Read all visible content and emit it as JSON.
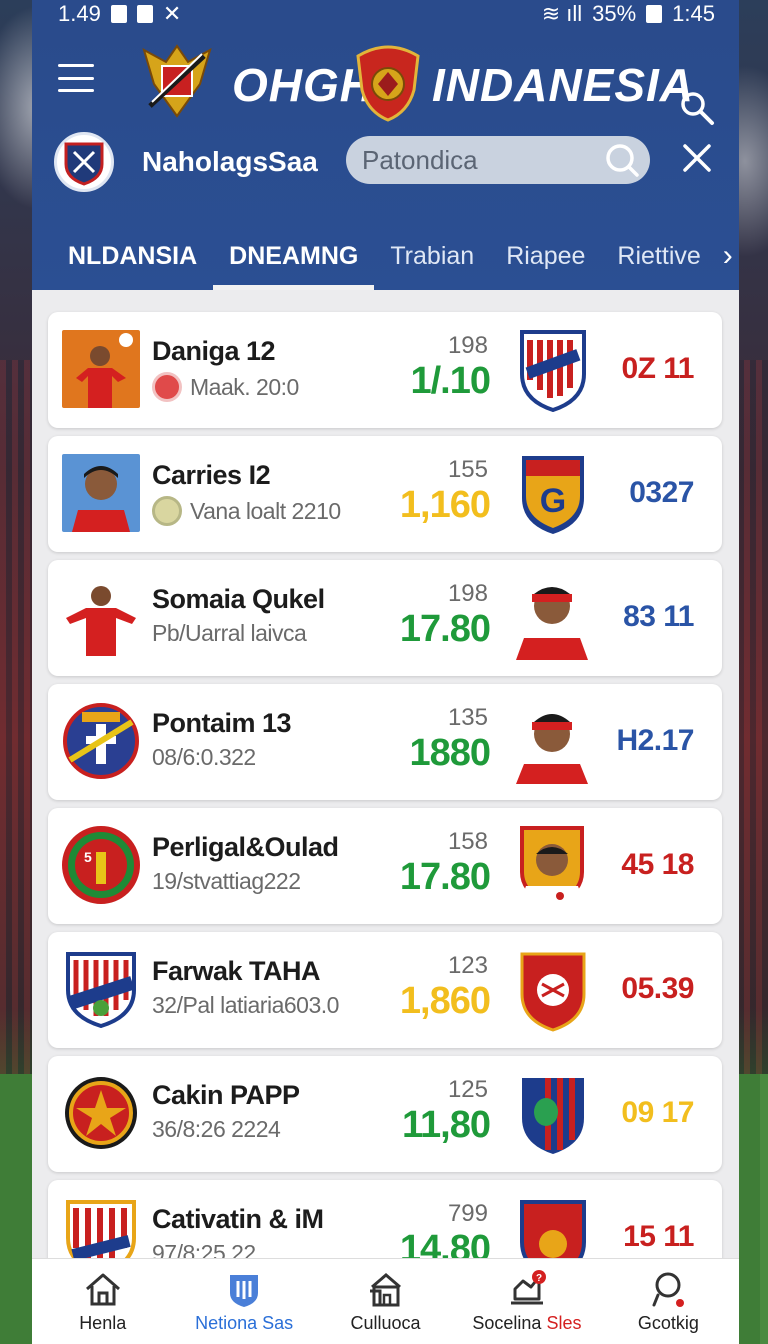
{
  "status": {
    "time_left": "1.49",
    "battery": "35%",
    "time_right": "1:45"
  },
  "header": {
    "brand_left": "OHGH",
    "brand_right": "INDANESIA",
    "username": "NaholagsSaa",
    "search_placeholder": "Patondica"
  },
  "tabs": [
    {
      "label": "NLDANSIA"
    },
    {
      "label": "DNEAMNG"
    },
    {
      "label": "Trabian"
    },
    {
      "label": "Riapee"
    },
    {
      "label": "Riettive"
    }
  ],
  "rows": [
    {
      "name": "Daniga 12",
      "sub": "Maak. 20:0",
      "small": "198",
      "big": "1/.10",
      "score": "0Z 11"
    },
    {
      "name": "Carries I2",
      "sub": "Vana loalt 2210",
      "small": "155",
      "big": "1,160",
      "score": "0327"
    },
    {
      "name": "Somaia Qukel",
      "sub": "Pb/Uarral laivca",
      "small": "198",
      "big": "17.80",
      "score": "83 11"
    },
    {
      "name": "Pontaim 13",
      "sub": "08/6:0.322",
      "small": "135",
      "big": "1880",
      "score": "H2.17"
    },
    {
      "name": "Perligal&Oulad",
      "sub": "19/stvattiag222",
      "small": "158",
      "big": "17.80",
      "score": "45 18"
    },
    {
      "name": "Farwak TAHA",
      "sub": "32/Pal latiaria603.0",
      "small": "123",
      "big": "1,860",
      "score": "05.39"
    },
    {
      "name": "Cakin PAPP",
      "sub": "36/8:26 2224",
      "small": "125",
      "big": "11,80",
      "score": "09 17"
    },
    {
      "name": "Cativatin & iM",
      "sub": "97/8:25.22",
      "small": "799",
      "big": "14.80",
      "score": "15 11"
    }
  ],
  "colors": {
    "green": "#1f9a3a",
    "yellow": "#f2be1e",
    "red": "#c8201f",
    "blue": "#2a54a6"
  },
  "nav": [
    {
      "label": "Henla",
      "icon": "home-icon"
    },
    {
      "label": "Netiona Sas",
      "icon": "shield-icon"
    },
    {
      "label": "Culluoca",
      "icon": "building-icon"
    },
    {
      "label": "Socelina Sles",
      "icon": "chart-icon"
    },
    {
      "label": "Gcotkig",
      "icon": "profile-icon"
    }
  ]
}
